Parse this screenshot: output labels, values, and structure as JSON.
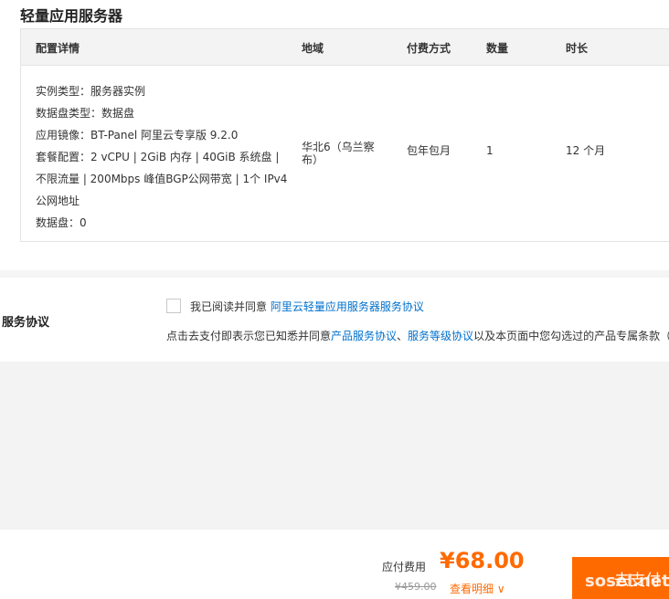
{
  "title": "轻量应用服务器",
  "table": {
    "headers": [
      "配置详情",
      "地域",
      "付费方式",
      "数量",
      "时长"
    ],
    "detail_lines": [
      "实例类型：服务器实例",
      "数据盘类型：数据盘",
      "应用镜像：BT-Panel 阿里云专享版 9.2.0",
      "套餐配置：2 vCPU | 2GiB 内存 | 40GiB 系统盘 |",
      "不限流量 | 200Mbps 峰值BGP公网带宽 | 1个 IPv4",
      "公网地址",
      "数据盘：0"
    ],
    "region": "华北6（乌兰察布）",
    "billing": "包年包月",
    "quantity": "1",
    "duration": "12 个月"
  },
  "agreement": {
    "title": "服务协议",
    "checked": false,
    "read_text": "我已阅读并同意",
    "read_link": "阿里云轻量应用服务器服务协议",
    "note_prefix": "点击去支付即表示您已知悉并同意",
    "note_link1": "产品服务协议",
    "note_sep": "、",
    "note_link2": "服务等级协议",
    "note_suffix": "以及本页面中您勾选过的产品专属条款（"
  },
  "footer": {
    "pay_label": "应付费用",
    "price": "¥68.00",
    "original_price": "¥459.00",
    "detail_link": "查看明细",
    "pay_button": "去支付",
    "accent_color": "#ff6a00"
  },
  "watermark": "sosel.net"
}
